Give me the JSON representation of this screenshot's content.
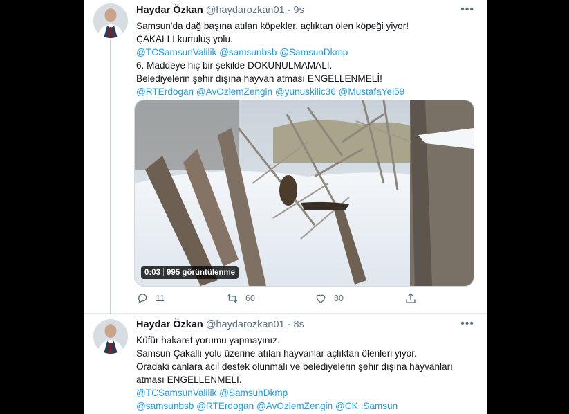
{
  "tweets": [
    {
      "name": "Haydar Özkan",
      "handle": "@haydarozkan01",
      "time": "9s",
      "dot": "·",
      "more": "•••",
      "lines": [
        {
          "text": "Samsun'da dağ başına atılan köpekler, açlıktan ölen köpeği yiyor!",
          "mentions": []
        },
        {
          "text": "ÇAKALLI kurtuluş yolu.",
          "mentions": []
        },
        {
          "text": "",
          "mentions": [
            "@TCSamsunValilik",
            "@samsunbsb",
            "@SamsunDkmp"
          ]
        },
        {
          "text": "6. Maddeye hiç bir şekilde DOKUNULMAMALI.",
          "mentions": []
        },
        {
          "text": "Belediyelerin şehir dışına hayvan atması ENGELLENMELİ!",
          "mentions": []
        },
        {
          "text": "",
          "mentions": [
            "@RTErdogan",
            "@AvOzlemZengin",
            "@yunuskilic36",
            "@MustafaYel59"
          ]
        }
      ],
      "media": {
        "duration": "0:03",
        "views": "995 görüntülenme"
      },
      "actions": {
        "replies": "11",
        "retweets": "60",
        "likes": "80"
      }
    },
    {
      "name": "Haydar Özkan",
      "handle": "@haydarozkan01",
      "time": "8s",
      "dot": "·",
      "more": "•••",
      "lines": [
        {
          "text": "Küfür hakaret yorumu yapmayınız.",
          "mentions": []
        },
        {
          "text": "Samsun Çakallı yolu üzerine atılan hayvanlar açlıktan ölenleri yiyor.",
          "mentions": []
        },
        {
          "text": "Oradaki canlara acil destek olunmalı ve belediyelerin şehir dışına hayvanları",
          "mentions": []
        },
        {
          "text": "atması ENGELLENMELİ.",
          "mentions": []
        },
        {
          "text": "",
          "mentions": [
            "@TCSamsunValilik",
            "@SamsunDkmp"
          ]
        },
        {
          "text": "",
          "mentions": [
            "@samsunbsb",
            "@RTErdogan",
            "@AvOzlemZengin",
            "@CK_Samsun"
          ]
        }
      ]
    }
  ],
  "colors": {
    "accent": "#1d9bf0",
    "secondary_text": "#5b7083",
    "background": "#000000",
    "panel": "#ffffff"
  },
  "icons": {
    "reply": "reply-icon",
    "retweet": "retweet-icon",
    "like": "heart-icon",
    "share": "share-icon",
    "more": "more-icon"
  }
}
